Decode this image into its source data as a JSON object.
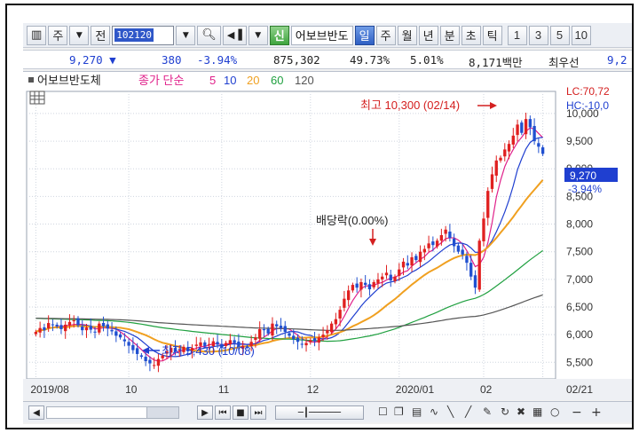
{
  "toolbar": {
    "market_label": "주",
    "history_label": "전",
    "code": "102120",
    "sin_label": "신",
    "stock_name": "어보브반도",
    "periods": [
      "일",
      "주",
      "월",
      "년",
      "분",
      "초",
      "틱"
    ],
    "active_period": "일",
    "intervals": [
      "1",
      "3",
      "5",
      "10"
    ]
  },
  "pricebar": {
    "price": "9,270",
    "change": "380",
    "change_pct": "-3.94%",
    "volume": "875,302",
    "volume_ratio": "49.73%",
    "rate": "5.01%",
    "amount": "8,171백만",
    "broker": "최우선",
    "bid": "9,2"
  },
  "legend": {
    "name": "어보브반도체",
    "ma_label": "종가 단순",
    "ma_periods": [
      "5",
      "10",
      "20",
      "60",
      "120"
    ],
    "ma_colors": [
      "#e0208a",
      "#1f3fd0",
      "#f0a020",
      "#20a040",
      "#555555"
    ]
  },
  "annotations": {
    "high_label": "최고 10,300 (02/14)",
    "low_label": "최저 5,430 (10/08)",
    "dividend_label": "배당락(0.00%)"
  },
  "right_labels": {
    "lc": "LC:70,72",
    "hc": "HC:-10,0",
    "current": "9,270",
    "current_pct": "-3.94%"
  },
  "axis": {
    "y_ticks": [
      "10,000",
      "9,500",
      "9,000",
      "8,500",
      "8,000",
      "7,500",
      "7,000",
      "6,500",
      "6,000",
      "5,500"
    ],
    "x_ticks": [
      "2019/08",
      "10",
      "11",
      "12",
      "2020/01",
      "02",
      "02/21"
    ]
  },
  "chart_data": {
    "type": "candlestick",
    "x_range": [
      "2019/08",
      "2020/02/21"
    ],
    "ylim": [
      5200,
      10400
    ],
    "high": {
      "value": 10300,
      "date": "02/14"
    },
    "low": {
      "value": 5430,
      "date": "10/08"
    },
    "last_close": 9270,
    "series": [
      {
        "name": "5",
        "color": "#e0208a"
      },
      {
        "name": "10",
        "color": "#1f3fd0"
      },
      {
        "name": "20",
        "color": "#f0a020"
      },
      {
        "name": "60",
        "color": "#20a040"
      },
      {
        "name": "120",
        "color": "#555555"
      }
    ],
    "closes": [
      6050,
      6120,
      6080,
      6210,
      6180,
      6150,
      6100,
      6180,
      6230,
      6260,
      6170,
      6080,
      6130,
      6090,
      6050,
      6200,
      6150,
      6110,
      6060,
      5980,
      5950,
      5880,
      5800,
      5720,
      5650,
      5600,
      5520,
      5480,
      5450,
      5560,
      5620,
      5700,
      5760,
      5690,
      5720,
      5780,
      5700,
      5760,
      5820,
      5860,
      5790,
      5830,
      5880,
      5820,
      5760,
      5850,
      5900,
      5850,
      5780,
      5800,
      5780,
      5870,
      5950,
      6100,
      6080,
      6020,
      6200,
      6150,
      6120,
      6050,
      5980,
      5920,
      5870,
      5820,
      5850,
      5900,
      5880,
      5950,
      6000,
      6080,
      6200,
      6280,
      6450,
      6650,
      6800,
      6900,
      6850,
      6950,
      6900,
      6820,
      6950,
      7000,
      7050,
      7120,
      6980,
      7050,
      7180,
      7320,
      7250,
      7400,
      7350,
      7500,
      7550,
      7650,
      7620,
      7700,
      7800,
      7900,
      7750,
      7600,
      7500,
      7450,
      7300,
      7050,
      6850,
      7700,
      8100,
      8600,
      8900,
      9150,
      9200,
      9350,
      9450,
      9600,
      9800,
      9650,
      9900,
      9750,
      9500,
      9400,
      9270
    ]
  }
}
